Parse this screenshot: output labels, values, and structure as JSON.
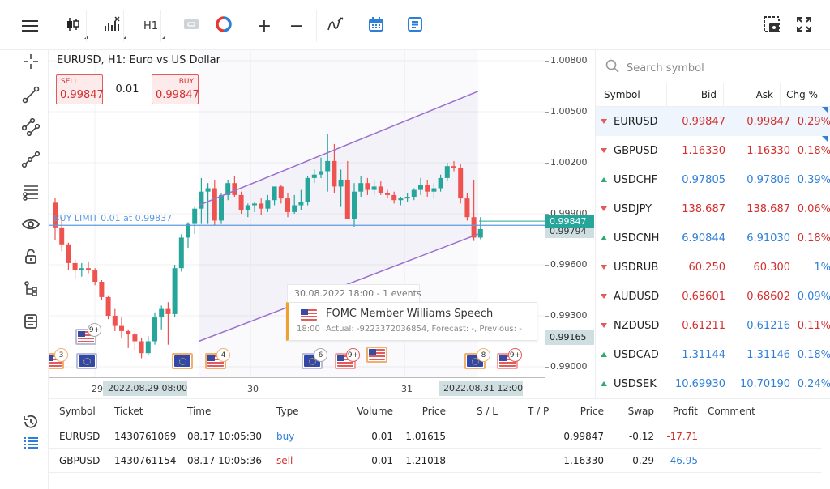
{
  "toolbar": {
    "menu_icon": "hamburger-menu-icon",
    "chart_type_icon": "candlestick-icon",
    "indicators_icon": "indicators-icon",
    "timeframe": "H1",
    "trade_icon": "one-click-trading-icon",
    "sync_icon": "sync-circle-icon",
    "zoom_in": "+",
    "zoom_out": "−",
    "objects_icon": "objects-wave-icon",
    "calendar_icon": "calendar-icon",
    "journal_icon": "journal-icon",
    "screenshot_icon": "screenshot-icon",
    "fullscreen_icon": "fullscreen-icon"
  },
  "left_tools": [
    "crosshair-icon",
    "trendline-icon",
    "channel-icon",
    "polyline-icon",
    "fibonacci-icon",
    "eye-icon",
    "lock-icon",
    "object-tree-icon",
    "delete-layers-icon"
  ],
  "chart": {
    "title": "EURUSD, H1: Euro vs US Dollar",
    "sell_label": "SELL",
    "sell_price": "0.99847",
    "volume": "0.01",
    "buy_label": "BUY",
    "buy_price": "0.99847",
    "order_line_label": "BUY LIMIT 0.01 at 0.99837",
    "price_axis": [
      "1.00800",
      "1.00500",
      "1.00200",
      "0.99900",
      "0.99600",
      "0.99300",
      "0.99000"
    ],
    "current_price": "0.99847",
    "order_price_tag": "0.99794",
    "low_price_tag": "0.99165",
    "time_axis": [
      "29",
      "30",
      "31"
    ],
    "crosshair_time_1": "2022.08.29 08:00",
    "crosshair_time_2": "2022.08.31 12:00",
    "colors": {
      "up": "#26a69a",
      "down": "#ef5350",
      "channel": "#9b6fd0",
      "order": "#5b9be0",
      "current": "#26a69a"
    }
  },
  "events_tooltip": {
    "header": "30.08.2022 18:00 - 1 events",
    "title": "FOMC Member Williams Speech",
    "time": "18:00",
    "details": "Actual: -9223372036854, Forecast: -, Previous: -"
  },
  "event_badges": [
    {
      "flag": "us",
      "count": "3"
    },
    {
      "flag": "us",
      "count": "9+"
    },
    {
      "flag": "eu",
      "count": ""
    },
    {
      "flag": "eu",
      "count": ""
    },
    {
      "flag": "us",
      "count": "4"
    },
    {
      "flag": "eu",
      "count": "6"
    },
    {
      "flag": "us",
      "count": "9+"
    },
    {
      "flag": "us",
      "count": ""
    },
    {
      "flag": "eu",
      "count": "8"
    },
    {
      "flag": "us",
      "count": "9+"
    }
  ],
  "chart_data": {
    "type": "candlestick",
    "symbol": "EURUSD",
    "timeframe": "H1",
    "ylim": [
      0.9895,
      1.0085
    ],
    "candles": [
      [
        0.99965,
        0.99995,
        0.99745,
        0.99815
      ],
      [
        0.99815,
        0.9988,
        0.9968,
        0.9972
      ],
      [
        0.9972,
        0.9973,
        0.9957,
        0.9961
      ],
      [
        0.9961,
        0.9963,
        0.9952,
        0.9957
      ],
      [
        0.9957,
        0.9961,
        0.9953,
        0.9958
      ],
      [
        0.9958,
        0.9962,
        0.9955,
        0.9957
      ],
      [
        0.9957,
        0.9958,
        0.9948,
        0.995
      ],
      [
        0.995,
        0.9951,
        0.9939,
        0.9941
      ],
      [
        0.9941,
        0.9942,
        0.9928,
        0.993
      ],
      [
        0.993,
        0.9934,
        0.9921,
        0.9924
      ],
      [
        0.9924,
        0.9929,
        0.9917,
        0.9921
      ],
      [
        0.9921,
        0.9922,
        0.9911,
        0.9919
      ],
      [
        0.9919,
        0.992,
        0.991,
        0.9915
      ],
      [
        0.9915,
        0.9917,
        0.9905,
        0.9908
      ],
      [
        0.9908,
        0.9918,
        0.9907,
        0.9915
      ],
      [
        0.9915,
        0.9932,
        0.9913,
        0.9929
      ],
      [
        0.9929,
        0.9936,
        0.9922,
        0.9934
      ],
      [
        0.9934,
        0.9938,
        0.9913,
        0.9931
      ],
      [
        0.9931,
        0.996,
        0.9929,
        0.9958
      ],
      [
        0.9958,
        0.9978,
        0.9956,
        0.9976
      ],
      [
        0.9976,
        0.9985,
        0.997,
        0.9984
      ],
      [
        0.9984,
        0.9994,
        0.9978,
        0.9993
      ],
      [
        0.9993,
        1.0011,
        0.9984,
        1.0003
      ],
      [
        1.0003,
        1.0008,
        0.9984,
        1.0005
      ],
      [
        1.0005,
        1.001,
        0.9983,
        0.9986
      ],
      [
        0.9986,
        1.0002,
        0.9984,
        1.0001
      ],
      [
        1.0001,
        1.001,
        0.9998,
        1.0008
      ],
      [
        1.0008,
        1.0012,
        1.0,
        1.0001
      ],
      [
        1.0001,
        1.0003,
        0.999,
        0.9992
      ],
      [
        0.9992,
        0.9996,
        0.9988,
        0.9995
      ],
      [
        0.9995,
        0.9997,
        0.9991,
        0.9996
      ],
      [
        0.9996,
        0.9999,
        0.9989,
        0.9993
      ],
      [
        0.9993,
        1.0001,
        0.9991,
        0.9998
      ],
      [
        0.9998,
        1.0005,
        0.9995,
        1.0006
      ],
      [
        1.0006,
        1.0007,
        0.9996,
        0.9999
      ],
      [
        0.9999,
        1.0002,
        0.9988,
        0.9991
      ],
      [
        0.9991,
        1.0001,
        0.999,
        0.9995
      ],
      [
        0.9995,
        1.0004,
        0.9992,
        0.9997
      ],
      [
        0.9997,
        1.0012,
        0.9995,
        1.0011
      ],
      [
        1.0011,
        1.0016,
        1.0008,
        1.0013
      ],
      [
        1.0013,
        1.0023,
        1.0011,
        1.0015
      ],
      [
        1.0015,
        1.0037,
        1.0003,
        1.0021
      ],
      [
        1.0021,
        1.0031,
        1.0002,
        1.0006
      ],
      [
        1.0006,
        1.0016,
        0.9994,
        1.001
      ],
      [
        1.001,
        1.0021,
        0.999,
        0.9987
      ],
      [
        0.9987,
        1.0008,
        0.9982,
        1.0003
      ],
      [
        1.0003,
        1.0012,
        1.0,
        1.0008
      ],
      [
        1.0008,
        1.0011,
        1.0001,
        1.0004
      ],
      [
        1.0004,
        1.001,
        1.0001,
        1.0006
      ],
      [
        1.0006,
        1.0009,
        1.0001,
        1.0002
      ],
      [
        1.0002,
        1.0004,
        0.9999,
        1.0001
      ],
      [
        1.0001,
        1.0003,
        0.9996,
        0.9998
      ],
      [
        0.9998,
        1.0,
        0.9995,
        0.9999
      ],
      [
        0.9999,
        1.0002,
        0.9997,
        1.0
      ],
      [
        1.0,
        1.0005,
        0.9998,
        1.0004
      ],
      [
        1.0004,
        1.0011,
        1.0001,
        1.0007
      ],
      [
        1.0007,
        1.001,
        1.0,
        1.0003
      ],
      [
        1.0003,
        1.0008,
        0.9999,
        1.0005
      ],
      [
        1.0005,
        1.0013,
        1.0003,
        1.0011
      ],
      [
        1.0011,
        1.002,
        1.0009,
        1.0018
      ],
      [
        1.0018,
        1.0021,
        1.0015,
        1.0017
      ],
      [
        1.0017,
        1.0019,
        0.9996,
        0.9999
      ],
      [
        0.9999,
        1.0002,
        0.9986,
        0.9988
      ],
      [
        0.9988,
        1.001,
        0.9974,
        0.9976
      ],
      [
        0.9976,
        0.9988,
        0.9975,
        0.9981
      ]
    ],
    "channel": {
      "upper": [
        [
          22,
          0.9995
        ],
        [
          64,
          1.0062
        ]
      ],
      "lower": [
        [
          22,
          0.9915
        ],
        [
          64,
          0.9978
        ]
      ],
      "fill_start": 22,
      "fill_end": 64
    },
    "order_level": 0.99837,
    "current_level": 0.99847,
    "yticks": [
      1.008,
      1.005,
      1.002,
      0.999,
      0.996,
      0.993,
      0.99
    ]
  },
  "watchlist": {
    "search_placeholder": "Search symbol",
    "headers": {
      "symbol": "Symbol",
      "bid": "Bid",
      "ask": "Ask",
      "chg": "Chg %"
    },
    "rows": [
      {
        "dir": "down",
        "symbol": "EURUSD",
        "bid": "0.99847",
        "bid_color": "red",
        "ask": "0.99847",
        "ask_color": "red",
        "chg": "0.29%",
        "chg_color": "red",
        "selected": true,
        "flag": true
      },
      {
        "dir": "down",
        "symbol": "GBPUSD",
        "bid": "1.16330",
        "bid_color": "red",
        "ask": "1.16330",
        "ask_color": "red",
        "chg": "0.18%",
        "chg_color": "red",
        "flag": true
      },
      {
        "dir": "up",
        "symbol": "USDCHF",
        "bid": "0.97805",
        "bid_color": "blue",
        "ask": "0.97806",
        "ask_color": "blue",
        "chg": "0.39%",
        "chg_color": "blue"
      },
      {
        "dir": "down",
        "symbol": "USDJPY",
        "bid": "138.687",
        "bid_color": "red",
        "ask": "138.687",
        "ask_color": "red",
        "chg": "0.06%",
        "chg_color": "red"
      },
      {
        "dir": "up",
        "symbol": "USDCNH",
        "bid": "6.90844",
        "bid_color": "blue",
        "ask": "6.91030",
        "ask_color": "blue",
        "chg": "0.18%",
        "chg_color": "red"
      },
      {
        "dir": "down",
        "symbol": "USDRUB",
        "bid": "60.250",
        "bid_color": "red",
        "ask": "60.300",
        "ask_color": "red",
        "chg": "1%",
        "chg_color": "blue"
      },
      {
        "dir": "down",
        "symbol": "AUDUSD",
        "bid": "0.68601",
        "bid_color": "red",
        "ask": "0.68602",
        "ask_color": "red",
        "chg": "0.09%",
        "chg_color": "blue"
      },
      {
        "dir": "down",
        "symbol": "NZDUSD",
        "bid": "0.61211",
        "bid_color": "red",
        "ask": "0.61216",
        "ask_color": "blue",
        "chg": "0.11%",
        "chg_color": "red"
      },
      {
        "dir": "up",
        "symbol": "USDCAD",
        "bid": "1.31144",
        "bid_color": "blue",
        "ask": "1.31146",
        "ask_color": "blue",
        "chg": "0.18%",
        "chg_color": "blue"
      },
      {
        "dir": "up",
        "symbol": "USDSEK",
        "bid": "10.69930",
        "bid_color": "blue",
        "ask": "10.70190",
        "ask_color": "blue",
        "chg": "0.24%",
        "chg_color": "blue"
      }
    ]
  },
  "bottom_tabs": {
    "history_icon": "history-icon",
    "trade_icon": "trade-list-icon"
  },
  "positions": {
    "headers": [
      "Symbol",
      "Ticket",
      "Time",
      "Type",
      "Volume",
      "Price",
      "S / L",
      "T / P",
      "Price",
      "Swap",
      "Profit",
      "Comment"
    ],
    "rows": [
      {
        "symbol": "EURUSD",
        "ticket": "1430761069",
        "time": "08.17 10:05:30",
        "type": "buy",
        "type_color": "blue",
        "volume": "0.01",
        "open_price": "1.01615",
        "sl": "",
        "tp": "",
        "price": "0.99847",
        "swap": "-0.12",
        "profit": "-17.71",
        "profit_color": "red",
        "comment": ""
      },
      {
        "symbol": "GBPUSD",
        "ticket": "1430761154",
        "time": "08.17 10:05:36",
        "type": "sell",
        "type_color": "red",
        "volume": "0.01",
        "open_price": "1.21018",
        "sl": "",
        "tp": "",
        "price": "1.16330",
        "swap": "-0.29",
        "profit": "46.95",
        "profit_color": "blue",
        "comment": ""
      }
    ]
  }
}
